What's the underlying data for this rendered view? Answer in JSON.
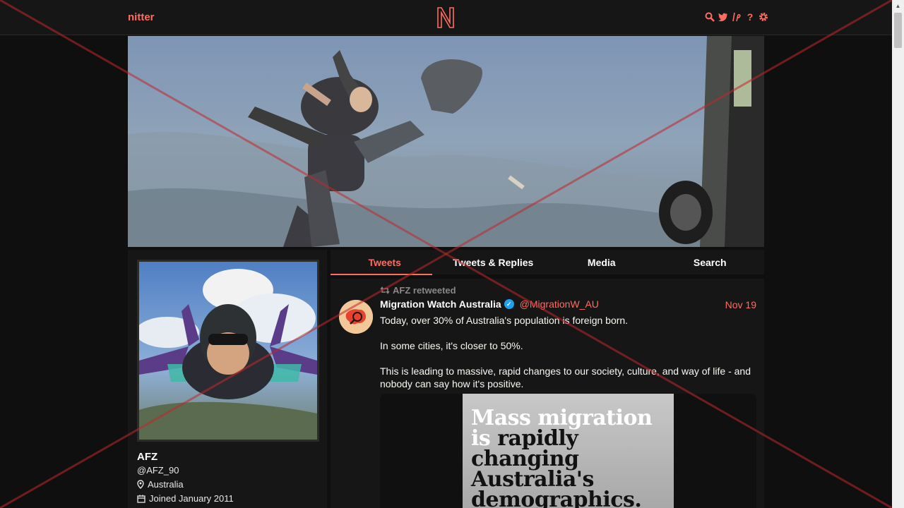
{
  "nav": {
    "brand": "nitter",
    "logo_letter": "N",
    "icons": [
      "search-icon",
      "twitter-icon",
      "lp-icon",
      "help-icon",
      "settings-icon"
    ]
  },
  "profile": {
    "fullname": "AFZ",
    "username": "@AFZ_90",
    "location": "Australia",
    "joined": "Joined January 2011"
  },
  "tabs": [
    {
      "label": "Tweets",
      "active": true
    },
    {
      "label": "Tweets & Replies",
      "active": false
    },
    {
      "label": "Media",
      "active": false
    },
    {
      "label": "Search",
      "active": false
    }
  ],
  "tweet": {
    "retweet_header": "AFZ retweeted",
    "fullname": "Migration Watch Australia",
    "handle": "@MigrationW_AU",
    "date": "Nov 19",
    "paragraphs": [
      "Today, over 30% of Australia's population is foreign born.",
      "In some cities, it's closer to 50%.",
      "This is leading to massive, rapid changes to our society, culture, and way of life - and nobody can say how it's positive."
    ],
    "image_text": {
      "line1": "Mass migration",
      "line2a": "is",
      "line2b": "rapidly",
      "line3": "changing",
      "line4": "Australia's",
      "line5": "demographics."
    }
  },
  "colors": {
    "accent": "#ff6c60",
    "background": "#0f0f0f",
    "panel": "#161616",
    "verified": "#1da1f2"
  }
}
